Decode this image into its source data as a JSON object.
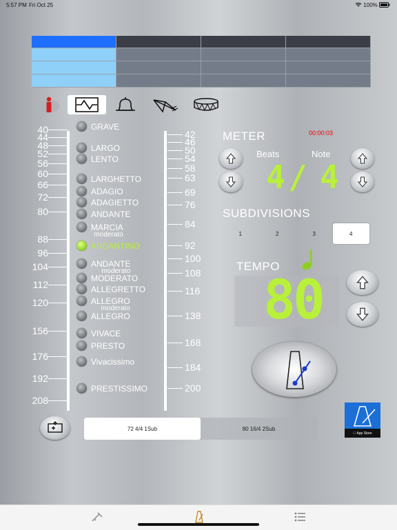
{
  "status_bar": {
    "time": "5:57 PM",
    "date": "Fri Oct 25",
    "battery": "100%",
    "wifi_icon": "wifi-icon"
  },
  "toolbar": {
    "icons": [
      "info-icon",
      "waveform-icon",
      "bell-icon",
      "plane-icon",
      "drum-icon"
    ],
    "info_color": "#d42020"
  },
  "ruler": {
    "left_values": [
      "40",
      "44",
      "48",
      "52",
      "56",
      "60",
      "66",
      "72",
      "80",
      "88",
      "96",
      "104",
      "112",
      "120",
      "156",
      "176",
      "192",
      "208"
    ],
    "right_values": [
      "42",
      "46",
      "50",
      "54",
      "58",
      "63",
      "69",
      "76",
      "84",
      "92",
      "100",
      "108",
      "116",
      "138",
      "168",
      "184",
      "200"
    ],
    "tempos": [
      {
        "name": "GRAVE",
        "sub": ""
      },
      {
        "name": "LARGO",
        "sub": ""
      },
      {
        "name": "LENTO",
        "sub": ""
      },
      {
        "name": "LARGHETTO",
        "sub": ""
      },
      {
        "name": "ADAGIO",
        "sub": ""
      },
      {
        "name": "ADAGIETTO",
        "sub": ""
      },
      {
        "name": "ANDANTE",
        "sub": ""
      },
      {
        "name": "MARCIA",
        "sub": "moderato"
      },
      {
        "name": "ANDANTINO",
        "sub": ""
      },
      {
        "name": "ANDANTE",
        "sub": "moderato"
      },
      {
        "name": "MODERATO",
        "sub": ""
      },
      {
        "name": "ALLEGRETTO",
        "sub": ""
      },
      {
        "name": "ALLEGRO",
        "sub": "moderato"
      },
      {
        "name": "ALLEGRO",
        "sub": ""
      },
      {
        "name": "VIVACE",
        "sub": ""
      },
      {
        "name": "PRESTO",
        "sub": ""
      },
      {
        "name": "Vivacissimo",
        "sub": ""
      },
      {
        "name": "PRESTISSIMO",
        "sub": ""
      }
    ],
    "active_tempo": "ANDANTINO",
    "accent_color": "#b8f03a"
  },
  "meter": {
    "label": "METER",
    "timer": "00:00:03",
    "beats_label": "Beats",
    "note_label": "Note",
    "beats_value": "4",
    "slash": "/",
    "note_value": "4"
  },
  "subdivisions": {
    "label": "SUBDIVISIONS",
    "options": [
      "1",
      "2",
      "3",
      "4"
    ],
    "selected": "4"
  },
  "tempo": {
    "label": "TEMPO",
    "value": "80",
    "note_icon": "quarter-note-icon"
  },
  "presets": {
    "items": [
      "72 4/4 1Sub",
      "80 16/4 2Sub"
    ],
    "selected": "72 4/4 1Sub"
  },
  "tabbar": {
    "icons": [
      "tuner-icon",
      "metronome-icon",
      "list-icon"
    ],
    "active_color": "#c88a2a"
  }
}
